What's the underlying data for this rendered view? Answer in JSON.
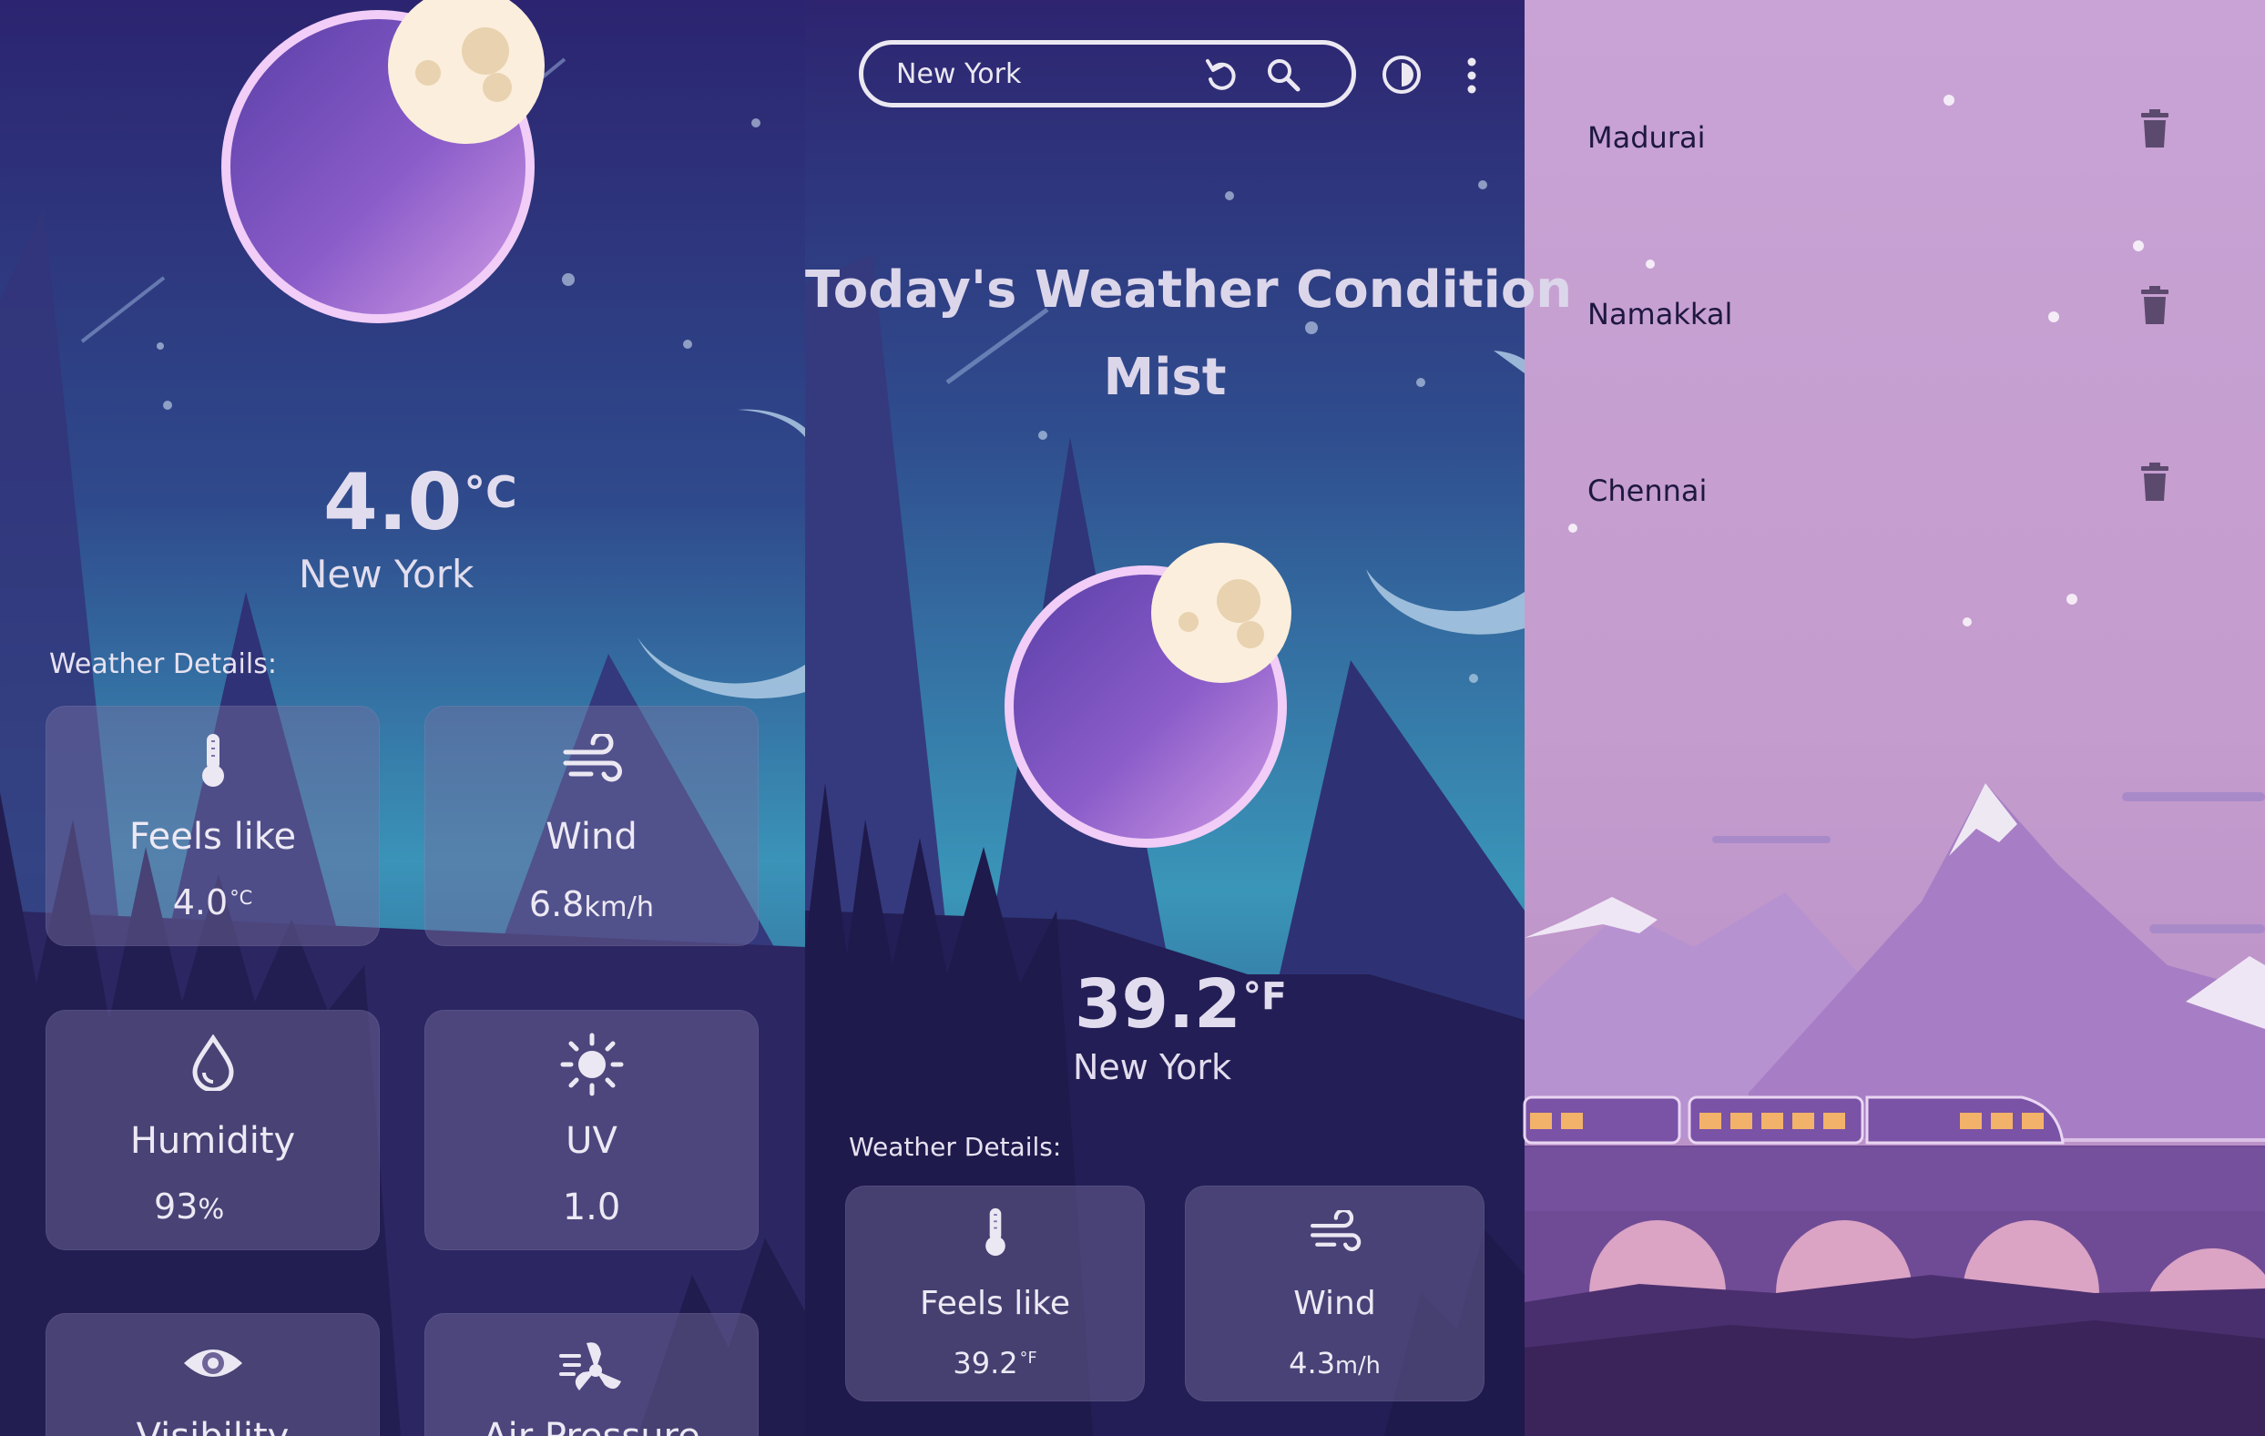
{
  "panel_left": {
    "temperature": "4.0",
    "temp_unit": "°C",
    "city": "New York",
    "details_heading": "Weather Details:",
    "cards": [
      {
        "icon": "thermometer-icon",
        "label": "Feels like",
        "value": "4.0",
        "unit": "°C"
      },
      {
        "icon": "wind-icon",
        "label": "Wind",
        "value": "6.8",
        "unit": "km/h"
      },
      {
        "icon": "droplet-icon",
        "label": "Humidity",
        "value": "93",
        "unit": "%"
      },
      {
        "icon": "sun-icon",
        "label": "UV",
        "value": "1.0",
        "unit": ""
      },
      {
        "icon": "eye-icon",
        "label": "Visibility",
        "value": "",
        "unit": ""
      },
      {
        "icon": "fan-icon",
        "label": "Air Pressure",
        "value": "",
        "unit": ""
      }
    ]
  },
  "panel_middle": {
    "search": {
      "value": "New York",
      "refresh_icon": "refresh-icon",
      "search_icon": "search-icon"
    },
    "theme_icon": "theme-toggle-icon",
    "menu_icon": "more-vertical-icon",
    "condition_title": "Today's Weather Condition",
    "condition": "Mist",
    "temperature": "39.2",
    "temp_unit": "°F",
    "city": "New York",
    "details_heading": "Weather Details:",
    "cards": [
      {
        "icon": "thermometer-icon",
        "label": "Feels like",
        "value": "39.2",
        "unit": "°F"
      },
      {
        "icon": "wind-icon",
        "label": "Wind",
        "value": "4.3",
        "unit": "m/h"
      }
    ]
  },
  "panel_right": {
    "cities": [
      {
        "name": "Madurai",
        "icon": "trash-icon"
      },
      {
        "name": "Namakkal",
        "icon": "trash-icon"
      },
      {
        "name": "Chennai",
        "icon": "trash-icon"
      }
    ]
  },
  "colors": {
    "night_top": "#2c2470",
    "night_bottom": "#3a93b8",
    "mountain": "#2d2a6e",
    "card": "#7a70a8",
    "dusk_sky": "#c6a1d0",
    "text_light": "#e7e2f0",
    "text_dark": "#1e1840"
  }
}
